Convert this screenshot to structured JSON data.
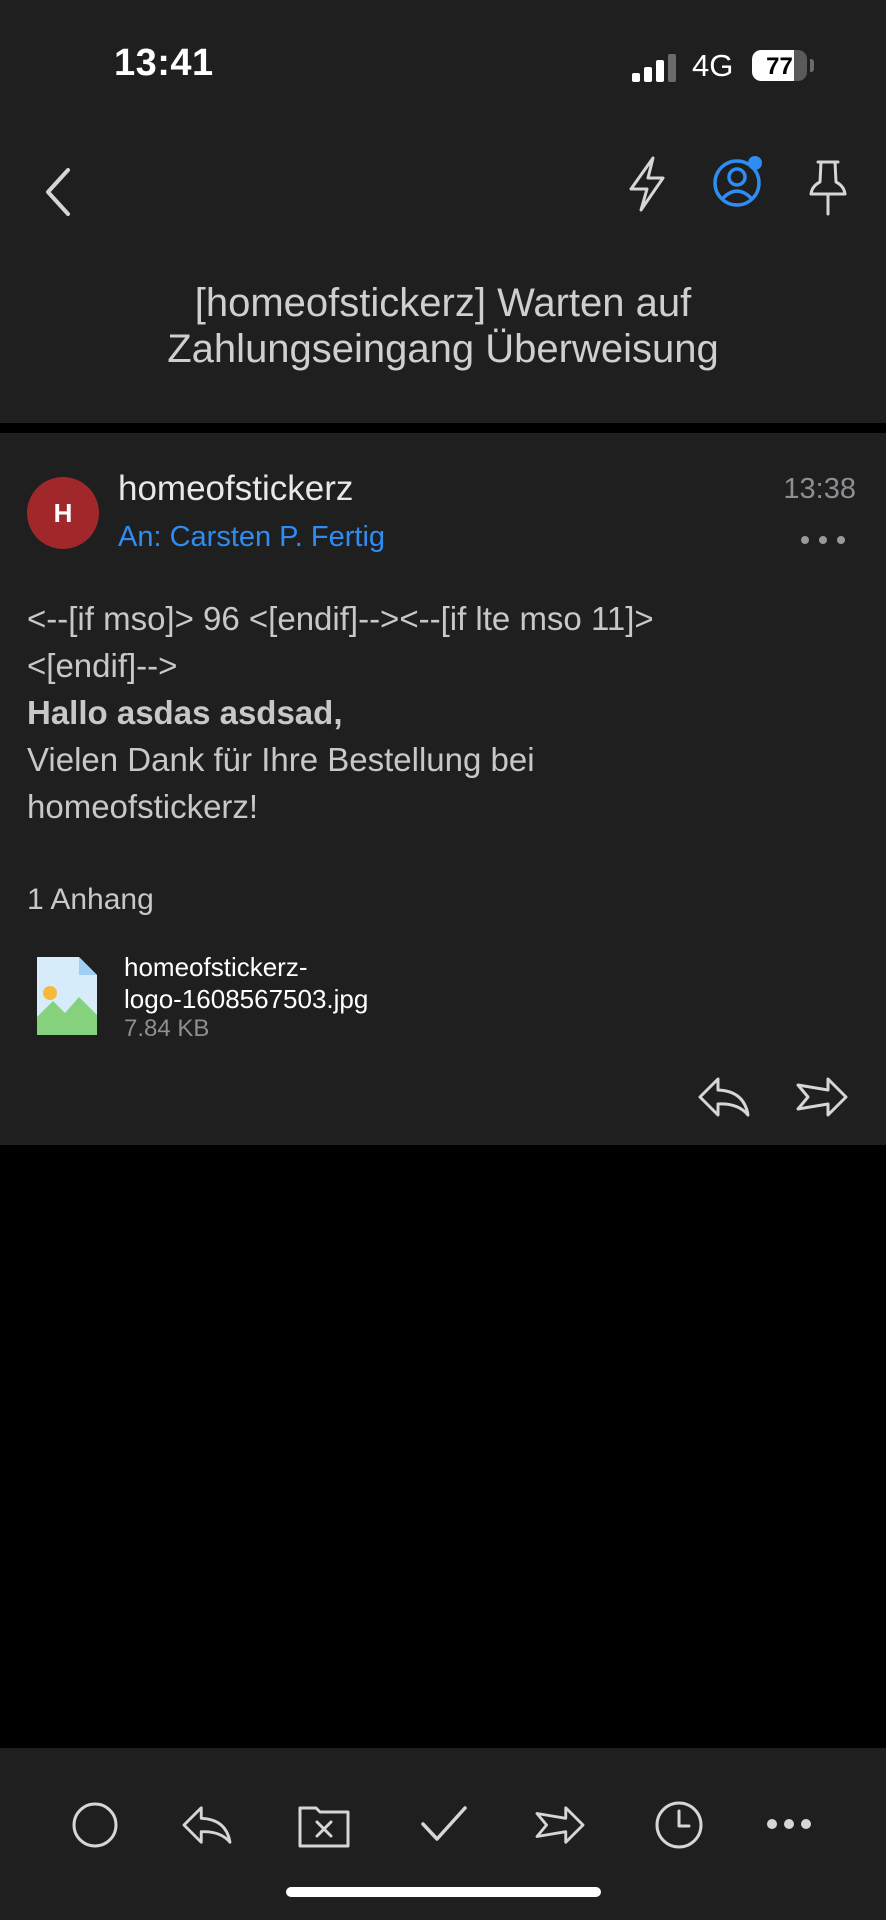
{
  "status_bar": {
    "time": "13:41",
    "network": "4G",
    "battery_level": 77,
    "battery_label": "77"
  },
  "header": {
    "back_icon": "chevron-left-icon",
    "actions": [
      "lightning-icon",
      "account-icon",
      "pin-icon"
    ],
    "subject_line1": "[homeofstickerz] Warten auf",
    "subject_line2": "Zahlungseingang Überweisung",
    "accent_color": "#2f8cf0"
  },
  "message": {
    "avatar_initial": "H",
    "avatar_color": "#a0282a",
    "sender": "homeofstickerz",
    "recipient": "An: Carsten P. Fertig",
    "time": "13:38",
    "body_lines": [
      "<--[if mso]> 96 <[endif]--><--[if lte mso 11]>",
      "<[endif]-->"
    ],
    "greeting": "Hallo asdas asdsad,",
    "thanks_line1": "Vielen Dank für Ihre Bestellung bei",
    "thanks_line2": "homeofstickerz!",
    "attachment_count": "1 Anhang",
    "attachment": {
      "name_line1": "homeofstickerz-",
      "name_line2": "logo-1608567503.jpg",
      "size": "7.84 KB"
    }
  },
  "toolbar": {
    "items": [
      "circle-icon",
      "reply-icon",
      "archive-folder-icon",
      "checkmark-icon",
      "forward-icon",
      "clock-icon",
      "more-icon"
    ]
  }
}
